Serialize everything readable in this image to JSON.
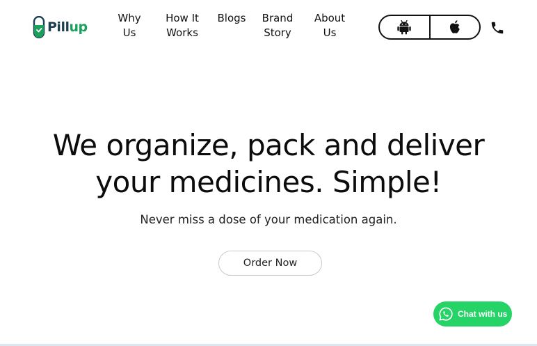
{
  "brand": {
    "name_part1": "Pill",
    "name_part2": "up",
    "dark_color": "#1d3f54",
    "accent_color": "#1aa05a"
  },
  "nav": {
    "items": [
      {
        "line1": "Why",
        "line2": "Us"
      },
      {
        "line1": "How It",
        "line2": "Works"
      },
      {
        "line1": "Blogs",
        "line2": ""
      },
      {
        "line1": "Brand",
        "line2": "Story"
      },
      {
        "line1": "About",
        "line2": "Us"
      }
    ]
  },
  "app_links": {
    "android_icon": "android-icon",
    "apple_icon": "apple-icon",
    "phone_icon": "phone-icon"
  },
  "hero": {
    "title_line1": "We organize, pack and deliver",
    "title_line2": "your medicines. Simple!",
    "subtitle": "Never miss a dose of your medication again.",
    "cta_label": "Order Now"
  },
  "chat": {
    "label": "Chat with us",
    "icon": "whatsapp-icon",
    "color": "#25d366"
  }
}
